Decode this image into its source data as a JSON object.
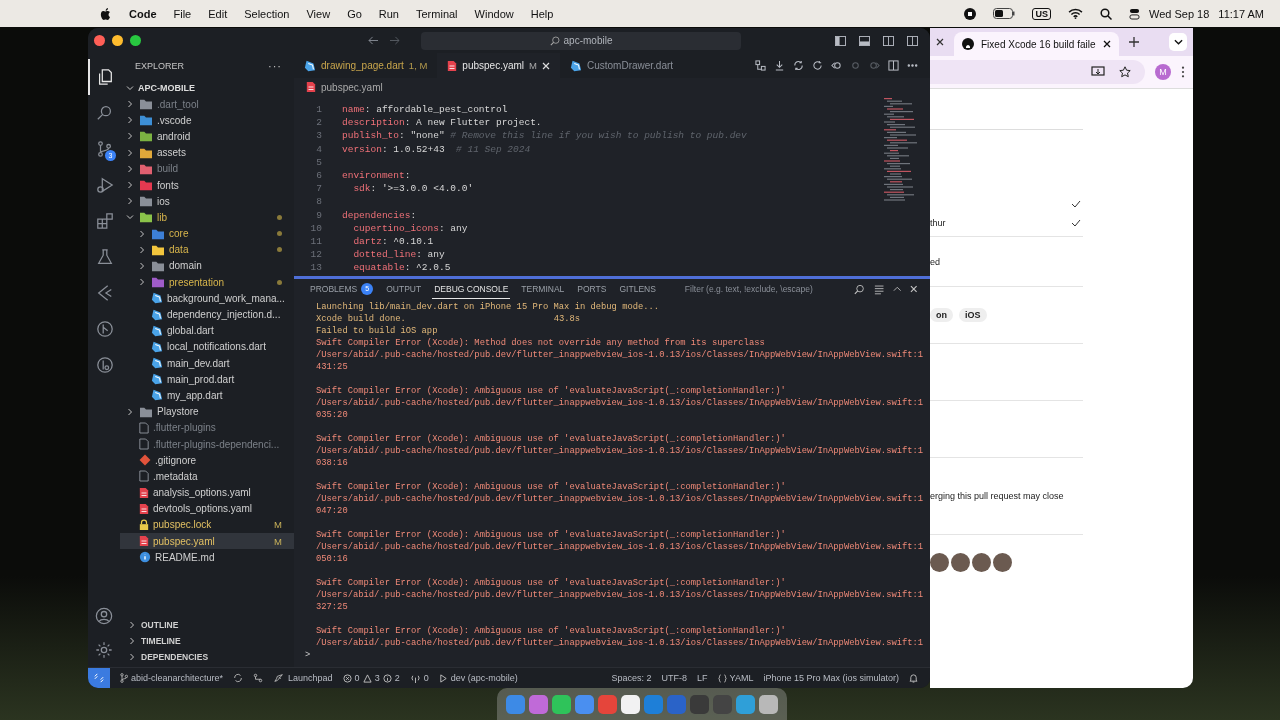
{
  "menubar": {
    "app": "Code",
    "menus": [
      "File",
      "Edit",
      "Selection",
      "View",
      "Go",
      "Run",
      "Terminal",
      "Window",
      "Help"
    ],
    "keyboard": "US",
    "date": "Wed Sep 18",
    "time": "11:17 AM"
  },
  "vscode": {
    "search": "apc-mobile",
    "explorer": {
      "title": "EXPLORER",
      "more": "···",
      "project": "APC-MOBILE",
      "tree": [
        {
          "label": ".dart_tool",
          "kind": "folder",
          "color": "#8a8f98",
          "expanded": false,
          "ignored": true,
          "changed": false,
          "modified": false,
          "selected": false
        },
        {
          "label": ".vscode",
          "kind": "folder",
          "color": "#3d8fd6",
          "expanded": false,
          "ignored": false,
          "changed": false,
          "modified": false,
          "selected": false
        },
        {
          "label": "android",
          "kind": "folder",
          "color": "#7cb342",
          "expanded": false,
          "ignored": false,
          "changed": false,
          "modified": false,
          "selected": false
        },
        {
          "label": "assets",
          "kind": "folder",
          "color": "#e0a83a",
          "expanded": false,
          "ignored": false,
          "changed": false,
          "modified": false,
          "selected": false
        },
        {
          "label": "build",
          "kind": "folder",
          "color": "#e06070",
          "expanded": false,
          "ignored": true,
          "changed": false,
          "modified": false,
          "selected": false
        },
        {
          "label": "fonts",
          "kind": "folder",
          "color": "#e53950",
          "expanded": false,
          "ignored": false,
          "changed": false,
          "modified": false,
          "selected": false
        },
        {
          "label": "ios",
          "kind": "folder",
          "color": "#8a8f98",
          "expanded": false,
          "ignored": false,
          "changed": false,
          "modified": false,
          "selected": false
        },
        {
          "label": "lib",
          "kind": "folder",
          "color": "#8bc34a",
          "expanded": true,
          "ignored": false,
          "changed": true,
          "modified": false,
          "selected": false,
          "children": [
            {
              "label": "core",
              "kind": "folder",
              "color": "#3d7fd6",
              "expanded": false,
              "ignored": false,
              "changed": true,
              "modified": false,
              "selected": false
            },
            {
              "label": "data",
              "kind": "folder",
              "color": "#f2c53d",
              "expanded": false,
              "ignored": false,
              "changed": true,
              "modified": false,
              "selected": false
            },
            {
              "label": "domain",
              "kind": "folder",
              "color": "#8a8f98",
              "expanded": false,
              "ignored": false,
              "changed": false,
              "modified": false,
              "selected": false
            },
            {
              "label": "presentation",
              "kind": "folder",
              "color": "#a05cc9",
              "expanded": false,
              "ignored": false,
              "changed": true,
              "modified": false,
              "selected": false
            },
            {
              "label": "background_work_mana...",
              "kind": "dart",
              "ignored": false,
              "changed": false,
              "modified": false,
              "selected": false
            },
            {
              "label": "dependency_injection.d...",
              "kind": "dart",
              "ignored": false,
              "changed": false,
              "modified": false,
              "selected": false
            },
            {
              "label": "global.dart",
              "kind": "dart",
              "ignored": false,
              "changed": false,
              "modified": false,
              "selected": false
            },
            {
              "label": "local_notifications.dart",
              "kind": "dart",
              "ignored": false,
              "changed": false,
              "modified": false,
              "selected": false
            },
            {
              "label": "main_dev.dart",
              "kind": "dart",
              "ignored": false,
              "changed": false,
              "modified": false,
              "selected": false
            },
            {
              "label": "main_prod.dart",
              "kind": "dart",
              "ignored": false,
              "changed": false,
              "modified": false,
              "selected": false
            },
            {
              "label": "my_app.dart",
              "kind": "dart",
              "ignored": false,
              "changed": false,
              "modified": false,
              "selected": false
            }
          ]
        },
        {
          "label": "Playstore",
          "kind": "folder",
          "color": "#8a8f98",
          "expanded": false,
          "ignored": false,
          "changed": false,
          "modified": false,
          "selected": false
        },
        {
          "label": ".flutter-plugins",
          "kind": "plain",
          "ignored": true,
          "changed": false,
          "modified": false,
          "selected": false
        },
        {
          "label": ".flutter-plugins-dependenci...",
          "kind": "plain",
          "ignored": true,
          "changed": false,
          "modified": false,
          "selected": false
        },
        {
          "label": ".gitignore",
          "kind": "git",
          "ignored": false,
          "changed": false,
          "modified": false,
          "selected": false
        },
        {
          "label": ".metadata",
          "kind": "plain",
          "ignored": false,
          "changed": false,
          "modified": false,
          "selected": false
        },
        {
          "label": "analysis_options.yaml",
          "kind": "yaml",
          "ignored": false,
          "changed": false,
          "modified": false,
          "selected": false
        },
        {
          "label": "devtools_options.yaml",
          "kind": "yaml",
          "ignored": false,
          "changed": false,
          "modified": false,
          "selected": false
        },
        {
          "label": "pubspec.lock",
          "kind": "lock",
          "ignored": false,
          "changed": false,
          "modified": true,
          "badge": "M",
          "selected": false
        },
        {
          "label": "pubspec.yaml",
          "kind": "yaml",
          "ignored": false,
          "changed": false,
          "modified": true,
          "badge": "M",
          "selected": true
        },
        {
          "label": "README.md",
          "kind": "info",
          "ignored": false,
          "changed": false,
          "modified": false,
          "selected": false
        }
      ],
      "sections": [
        "OUTLINE",
        "TIMELINE",
        "DEPENDENCIES"
      ]
    },
    "activity": [
      {
        "kind": "files",
        "selected": true
      },
      {
        "kind": "search",
        "selected": false
      },
      {
        "kind": "scm",
        "selected": false,
        "badge": "3"
      },
      {
        "kind": "debug",
        "selected": false
      },
      {
        "kind": "extensions",
        "selected": false
      },
      {
        "kind": "testing",
        "selected": false
      },
      {
        "kind": "flutter",
        "selected": false
      },
      {
        "kind": "gitlens",
        "selected": false
      },
      {
        "kind": "graph",
        "selected": false
      }
    ],
    "tabs": [
      {
        "label": "drawing_page.dart",
        "suffix": "1, M",
        "kind": "dart",
        "modified": true,
        "selected": false
      },
      {
        "label": "pubspec.yaml",
        "suffix": "M",
        "kind": "yaml",
        "modified": true,
        "selected": true
      },
      {
        "label": "CustomDrawer.dart",
        "kind": "dart",
        "modified": false,
        "selected": false
      }
    ],
    "breadcrumb": "pubspec.yaml",
    "code": [
      {
        "number": "1",
        "segments": [
          {
            "text": "name",
            "kind": "key"
          },
          {
            "text": ": affordable_pest_control",
            "kind": "value"
          }
        ]
      },
      {
        "number": "2",
        "segments": [
          {
            "text": "description",
            "kind": "key"
          },
          {
            "text": ": A new Flutter project.",
            "kind": "value"
          }
        ]
      },
      {
        "number": "3",
        "segments": [
          {
            "text": "publish_to",
            "kind": "key"
          },
          {
            "text": ": \"none\" ",
            "kind": "value"
          },
          {
            "text": "# Remove this line if you wish to publish to pub.dev",
            "kind": "comment"
          }
        ]
      },
      {
        "number": "4",
        "segments": [
          {
            "text": "version",
            "kind": "key"
          },
          {
            "text": ": 1.0.52+43  ",
            "kind": "value"
          },
          {
            "text": "# 11 Sep 2024",
            "kind": "comment"
          }
        ]
      },
      {
        "number": "5"
      },
      {
        "number": "6",
        "segments": [
          {
            "text": "environment",
            "kind": "key"
          },
          {
            "text": ":",
            "kind": "value"
          }
        ]
      },
      {
        "number": "7",
        "segments": [
          {
            "text": "  sdk",
            "kind": "key"
          },
          {
            "text": ": '>=3.0.0 <4.0.0'",
            "kind": "value"
          }
        ]
      },
      {
        "number": "8"
      },
      {
        "number": "9",
        "segments": [
          {
            "text": "dependencies",
            "kind": "key"
          },
          {
            "text": ":",
            "kind": "value"
          }
        ]
      },
      {
        "number": "10",
        "segments": [
          {
            "text": "  cupertino_icons",
            "kind": "key"
          },
          {
            "text": ": any",
            "kind": "value"
          }
        ]
      },
      {
        "number": "11",
        "segments": [
          {
            "text": "  dartz",
            "kind": "key"
          },
          {
            "text": ": ^0.10.1",
            "kind": "value"
          }
        ]
      },
      {
        "number": "12",
        "segments": [
          {
            "text": "  dotted_line",
            "kind": "key"
          },
          {
            "text": ": any",
            "kind": "value"
          }
        ]
      },
      {
        "number": "13",
        "segments": [
          {
            "text": "  equatable",
            "kind": "key"
          },
          {
            "text": ": ^2.0.5",
            "kind": "value"
          }
        ]
      }
    ],
    "panel_tabs": [
      {
        "label": "PROBLEMS",
        "badge": "5",
        "selected": false
      },
      {
        "label": "OUTPUT",
        "selected": false
      },
      {
        "label": "DEBUG CONSOLE",
        "selected": true
      },
      {
        "label": "TERMINAL",
        "selected": false
      },
      {
        "label": "PORTS",
        "selected": false
      },
      {
        "label": "GITLENS",
        "selected": false
      }
    ],
    "filter_placeholder": "Filter (e.g. text, !exclude, \\escape)",
    "console": [
      {
        "text": "Launching lib/main_dev.dart on iPhone 15 Pro Max in debug mode...",
        "kind": "info"
      },
      {
        "text": "Xcode build done.",
        "time": "43.8s",
        "kind": "info"
      },
      {
        "text": "Failed to build iOS app",
        "kind": "info"
      },
      {
        "text": "Swift Compiler Error (Xcode): Method does not override any method from its superclass",
        "kind": "error"
      },
      {
        "text": "/Users/abid/.pub-cache/hosted/pub.dev/flutter_inappwebview_ios-1.0.13/ios/Classes/InAppWebView/InAppWebView.swift:1",
        "kind": "error"
      },
      {
        "text": "431:25",
        "kind": "error"
      },
      {
        "kind": "blank"
      },
      {
        "text": "Swift Compiler Error (Xcode): Ambiguous use of 'evaluateJavaScript(_:completionHandler:)'",
        "kind": "error"
      },
      {
        "text": "/Users/abid/.pub-cache/hosted/pub.dev/flutter_inappwebview_ios-1.0.13/ios/Classes/InAppWebView/InAppWebView.swift:1",
        "kind": "error"
      },
      {
        "text": "035:20",
        "kind": "error"
      },
      {
        "kind": "blank"
      },
      {
        "text": "Swift Compiler Error (Xcode): Ambiguous use of 'evaluateJavaScript(_:completionHandler:)'",
        "kind": "error"
      },
      {
        "text": "/Users/abid/.pub-cache/hosted/pub.dev/flutter_inappwebview_ios-1.0.13/ios/Classes/InAppWebView/InAppWebView.swift:1",
        "kind": "error"
      },
      {
        "text": "038:16",
        "kind": "error"
      },
      {
        "kind": "blank"
      },
      {
        "text": "Swift Compiler Error (Xcode): Ambiguous use of 'evaluateJavaScript(_:completionHandler:)'",
        "kind": "error"
      },
      {
        "text": "/Users/abid/.pub-cache/hosted/pub.dev/flutter_inappwebview_ios-1.0.13/ios/Classes/InAppWebView/InAppWebView.swift:1",
        "kind": "error"
      },
      {
        "text": "047:20",
        "kind": "error"
      },
      {
        "kind": "blank"
      },
      {
        "text": "Swift Compiler Error (Xcode): Ambiguous use of 'evaluateJavaScript(_:completionHandler:)'",
        "kind": "error"
      },
      {
        "text": "/Users/abid/.pub-cache/hosted/pub.dev/flutter_inappwebview_ios-1.0.13/ios/Classes/InAppWebView/InAppWebView.swift:1",
        "kind": "error"
      },
      {
        "text": "050:16",
        "kind": "error"
      },
      {
        "kind": "blank"
      },
      {
        "text": "Swift Compiler Error (Xcode): Ambiguous use of 'evaluateJavaScript(_:completionHandler:)'",
        "kind": "error"
      },
      {
        "text": "/Users/abid/.pub-cache/hosted/pub.dev/flutter_inappwebview_ios-1.0.13/ios/Classes/InAppWebView/InAppWebView.swift:1",
        "kind": "error"
      },
      {
        "text": "327:25",
        "kind": "error"
      },
      {
        "kind": "blank"
      },
      {
        "text": "Swift Compiler Error (Xcode): Ambiguous use of 'evaluateJavaScript(_:completionHandler:)'",
        "kind": "error"
      },
      {
        "text": "/Users/abid/.pub-cache/hosted/pub.dev/flutter_inappwebview_ios-1.0.13/ios/Classes/InAppWebView/InAppWebView.swift:1",
        "kind": "error"
      }
    ],
    "prompt": ">",
    "status": {
      "branch": "abid-cleanarchitecture*",
      "launchpad": "Launchpad",
      "errors": "0",
      "warnings": "3",
      "infos": "2",
      "ports": "0",
      "target": "dev (apc-mobile)",
      "spaces": "Spaces: 2",
      "encoding": "UTF-8",
      "eol": "LF",
      "language": "YAML",
      "device": "iPhone 15 Pro Max (ios simulator)"
    }
  },
  "browser": {
    "tab_title": "Fixed Xcode 16 build faile",
    "avatar": "M",
    "rows": [
      {
        "kind": "check",
        "checked": true
      },
      {
        "kind": "text",
        "text": "thur",
        "checked": true
      },
      {
        "kind": "text",
        "text": "ed"
      },
      {
        "kind": "tags",
        "tags": [
          "on",
          "iOS"
        ]
      },
      {
        "kind": "empty"
      },
      {
        "kind": "empty"
      },
      {
        "kind": "text",
        "text": "erging this pull request may close"
      },
      {
        "kind": "avatars"
      }
    ]
  }
}
